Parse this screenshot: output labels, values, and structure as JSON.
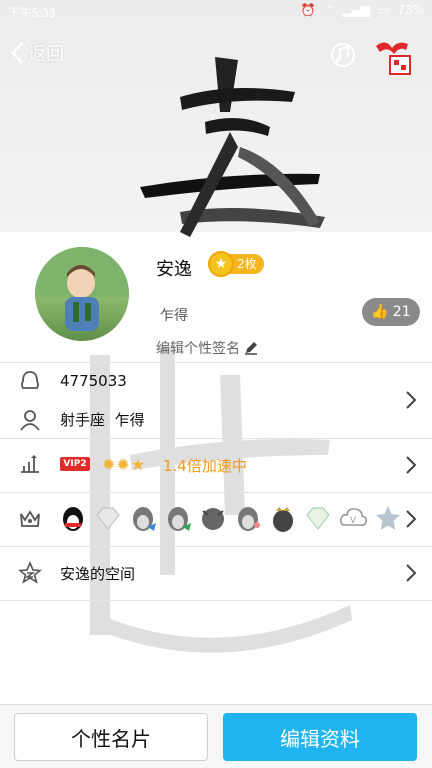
{
  "status": {
    "time": "下午5:33",
    "battery": "73%"
  },
  "nav": {
    "back_label": "返回"
  },
  "profile": {
    "name": "安逸",
    "level_label": "2枚",
    "nickname": "乍得",
    "signature_placeholder": "编辑个性签名",
    "likes": "21"
  },
  "rows": {
    "qq_number": "4775033",
    "zodiac": "射手座",
    "location": "乍得",
    "vip_tag": "VIP2",
    "speed_text": "1.4倍加速中",
    "space_label": "安逸的空间"
  },
  "badges": [
    "penguin-red-icon",
    "diamond-love-icon",
    "penguin-grey-icon",
    "penguin-green-icon",
    "penguin-wolf-icon",
    "penguin-hat-icon",
    "penguin-crown-icon",
    "diamond-green-icon",
    "cloud-v-icon",
    "star-icon"
  ],
  "buttons": {
    "card_label": "个性名片",
    "edit_label": "编辑资料"
  },
  "colors": {
    "accent": "#1fb4f0",
    "vip": "#e32d2d",
    "speed": "#f29a1d",
    "level": "#f5b51f"
  }
}
